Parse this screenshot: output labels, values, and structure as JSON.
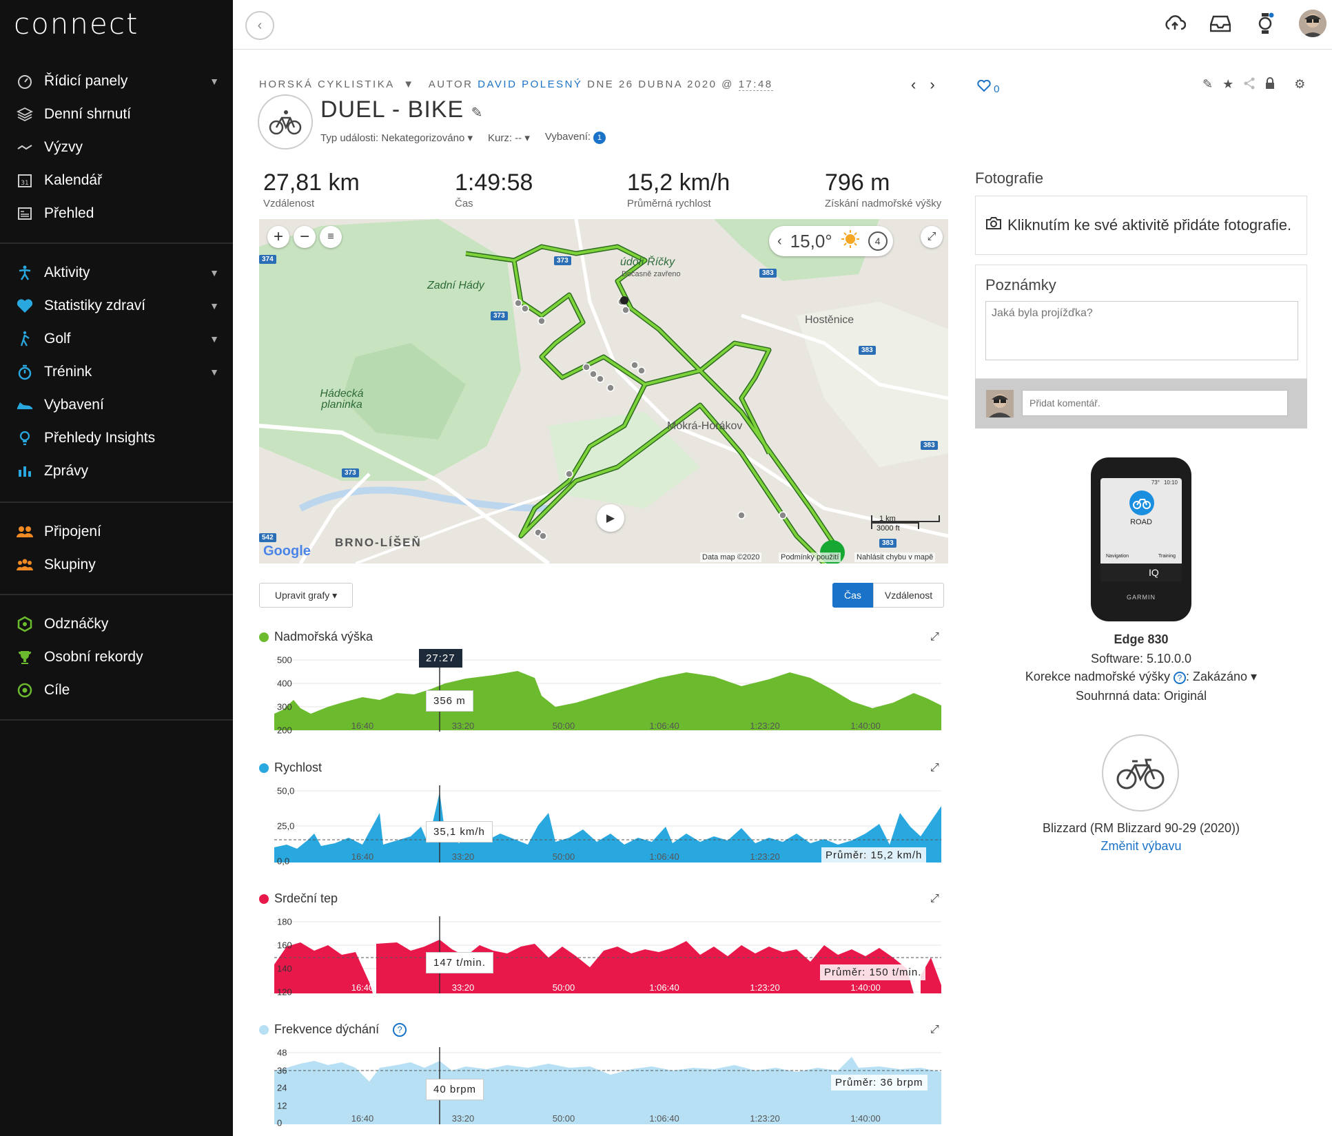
{
  "app": {
    "logo": "connect"
  },
  "sidebar": {
    "group1": [
      {
        "label": "Řídicí panely",
        "icon": "gauge-icon",
        "chevron": true
      },
      {
        "label": "Denní shrnutí",
        "icon": "layers-icon",
        "chevron": false
      },
      {
        "label": "Výzvy",
        "icon": "trend-icon",
        "chevron": false
      },
      {
        "label": "Kalendář",
        "icon": "calendar-icon",
        "chevron": false,
        "calendar_day": "31"
      },
      {
        "label": "Přehled",
        "icon": "newspaper-icon",
        "chevron": false
      }
    ],
    "group2": [
      {
        "label": "Aktivity",
        "icon": "runner-icon",
        "chevron": true
      },
      {
        "label": "Statistiky zdraví",
        "icon": "heart-icon",
        "chevron": true
      },
      {
        "label": "Golf",
        "icon": "golfer-icon",
        "chevron": true
      },
      {
        "label": "Trénink",
        "icon": "stopwatch-icon",
        "chevron": true
      },
      {
        "label": "Vybavení",
        "icon": "shoe-icon",
        "chevron": false
      },
      {
        "label": "Přehledy Insights",
        "icon": "lightbulb-icon",
        "chevron": false
      },
      {
        "label": "Zprávy",
        "icon": "bar-chart-icon",
        "chevron": false
      }
    ],
    "group3": [
      {
        "label": "Připojení",
        "icon": "people-icon",
        "chevron": false
      },
      {
        "label": "Skupiny",
        "icon": "group-icon",
        "chevron": false
      }
    ],
    "group4": [
      {
        "label": "Odznáčky",
        "icon": "badge-icon",
        "chevron": false
      },
      {
        "label": "Osobní rekordy",
        "icon": "trophy-icon",
        "chevron": false
      },
      {
        "label": "Cíle",
        "icon": "target-icon",
        "chevron": false
      }
    ]
  },
  "colors": {
    "sidebar_bg": "#111111",
    "accent": "#1a73c8",
    "elevation": "#6cbb2f",
    "speed": "#29a8e0",
    "heart": "#e8194a",
    "breath": "#b7e0f4"
  },
  "header": {
    "activity_type": "HORSKÁ CYKLISTIKA",
    "author_prefix": "AUTOR",
    "author": "DAVID POLESNÝ",
    "date": "DNE 26 DUBNA 2020 @",
    "time": "17:48",
    "likes": "0",
    "title": "DUEL - BIKE",
    "event_type": "Typ události: Nekategorizováno",
    "course": "Kurz: --",
    "gear": "Vybavení:",
    "gear_count": "1"
  },
  "stats": [
    {
      "value": "27,81 km",
      "label": "Vzdálenost"
    },
    {
      "value": "1:49:58",
      "label": "Čas"
    },
    {
      "value": "15,2 km/h",
      "label": "Průměrná rychlost"
    },
    {
      "value": "796 m",
      "label": "Získání nadmořské výšky"
    }
  ],
  "map": {
    "temperature": "15,0°",
    "wind": "4",
    "places": [
      "Zadní Hády",
      "Hádecká planinka",
      "Hostěnice",
      "Mokrá-Horákov",
      "BRNO-LÍŠEŇ",
      "údolí Říčky",
      "Dočasně zavřeno"
    ],
    "road_shields": [
      "374",
      "373",
      "373",
      "373",
      "383",
      "383",
      "383",
      "383",
      "542"
    ],
    "scale_km": "1 km",
    "scale_ft": "3000 ft",
    "attribution": "Data map ©2020",
    "terms": "Podmínky použití",
    "report": "Nahlásit chybu v mapě",
    "google": "Google"
  },
  "controls": {
    "edit_charts": "Upravit grafy",
    "toggle_time": "Čas",
    "toggle_distance": "Vzdálenost"
  },
  "charts": {
    "x_ticks": [
      "16:40",
      "33:20",
      "50:00",
      "1:06:40",
      "1:23:20",
      "1:40:00"
    ],
    "elevation": {
      "title": "Nadmořská výška",
      "y_ticks": [
        "500",
        "400",
        "300",
        "200"
      ],
      "cursor_time": "27:27",
      "tooltip": "356 m"
    },
    "speed": {
      "title": "Rychlost",
      "y_ticks": [
        "50,0",
        "25,0",
        "0,0"
      ],
      "tooltip": "35,1 km/h",
      "avg": "Průměr: 15,2 km/h"
    },
    "heart": {
      "title": "Srdeční tep",
      "y_ticks": [
        "180",
        "160",
        "140",
        "120"
      ],
      "tooltip": "147 t/min.",
      "avg": "Průměr: 150 t/min."
    },
    "breath": {
      "title": "Frekvence dýchání",
      "y_ticks": [
        "48",
        "36",
        "24",
        "12",
        "0"
      ],
      "tooltip": "40 brpm",
      "avg": "Průměr: 36 brpm"
    }
  },
  "side": {
    "photos_title": "Fotografie",
    "photos_cta": "Kliknutím ke své aktivitě přidáte fotografie.",
    "notes_title": "Poznámky",
    "notes_placeholder": "Jaká byla projížďka?",
    "comment_placeholder": "Přidat komentář.",
    "device_name": "Edge 830",
    "software": "Software: 5.10.0.0",
    "elev_correction_label": "Korekce nadmořské výšky",
    "elev_correction_value": ": Zakázáno",
    "summary_data": "Souhrnná data: Originál",
    "device_screen_road": "ROAD",
    "device_screen_nav": "Navigation",
    "device_screen_training": "Training",
    "device_screen_iq": "IQ",
    "device_brand": "GARMIN",
    "device_screen_temp": "73°",
    "device_screen_time": "10:10",
    "bike_name": "Blizzard (RM Blizzard 90-29 (2020))",
    "change_gear": "Změnit výbavu"
  }
}
